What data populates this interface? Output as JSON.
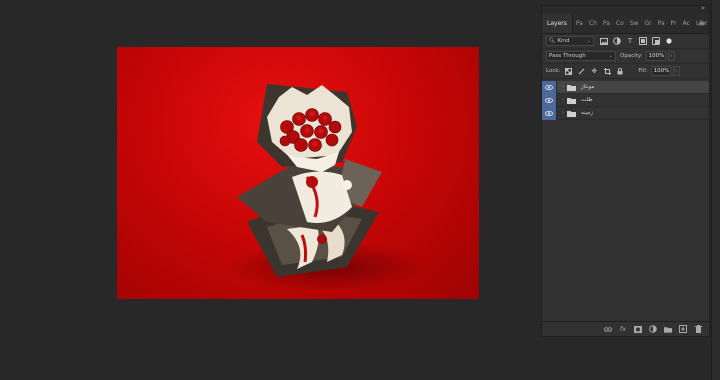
{
  "panel": {
    "tabs": [
      {
        "label": "Layers",
        "active": true
      },
      {
        "label": "Pa"
      },
      {
        "label": "Ch"
      },
      {
        "label": "Pa"
      },
      {
        "label": "Co"
      },
      {
        "label": "Sw"
      },
      {
        "label": "Gr"
      },
      {
        "label": "Pa"
      },
      {
        "label": "Pr"
      },
      {
        "label": "Ac"
      },
      {
        "label": "Libr"
      }
    ],
    "filter": {
      "kind_label": "Kind",
      "icons": [
        "image-filter-icon",
        "adjustment-filter-icon",
        "type-filter-icon",
        "shape-filter-icon",
        "smart-object-filter-icon",
        "filter-toggle-icon"
      ]
    },
    "blend": {
      "mode": "Pass Through",
      "opacity_label": "Opacity:",
      "opacity_value": "100%"
    },
    "lock": {
      "label": "Lock:",
      "icons": [
        "lock-transparent-icon",
        "lock-pixels-icon",
        "lock-position-icon",
        "lock-artboard-icon",
        "lock-all-icon"
      ],
      "fill_label": "Fill:",
      "fill_value": "100%"
    },
    "layers": [
      {
        "name": "مونتاژ",
        "selected": true
      },
      {
        "name": "ظلت"
      },
      {
        "name": "زمینه"
      }
    ],
    "bottom_icons": [
      "link-layers-icon",
      "fx-icon",
      "layer-mask-icon",
      "adjustment-layer-icon",
      "new-group-icon",
      "new-layer-icon",
      "trash-icon"
    ],
    "bottom_labels": {
      "fx": "fx"
    }
  },
  "canvas": {
    "background_color": "#d00808"
  }
}
